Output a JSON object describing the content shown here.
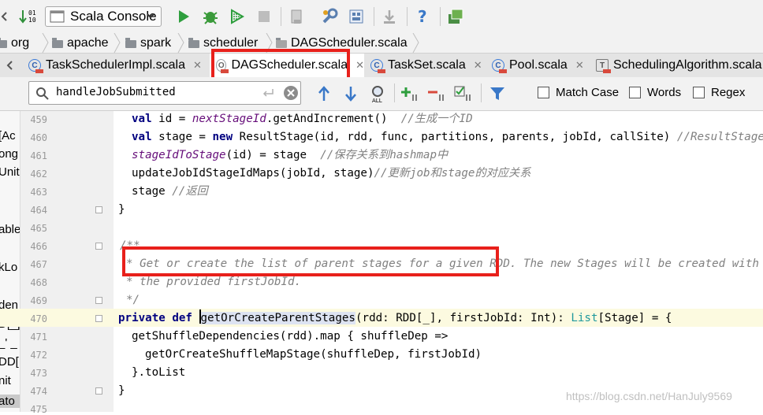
{
  "toolbar": {
    "run_config": "Scala Console",
    "icons": [
      "sort-down-icon",
      "run-icon",
      "debug-icon",
      "coverage-icon",
      "stop-icon",
      "build-icon",
      "wrench-icon",
      "project-structure-icon",
      "download-icon",
      "help-icon",
      "vcs-icon"
    ]
  },
  "breadcrumb": [
    "org",
    "apache",
    "spark",
    "scheduler",
    "DAGScheduler.scala"
  ],
  "tabs": [
    {
      "label": "TaskSchedulerImpl.scala",
      "icon": "class"
    },
    {
      "label": "DAGScheduler.scala",
      "icon": "object"
    },
    {
      "label": "TaskSet.scala",
      "icon": "class"
    },
    {
      "label": "Pool.scala",
      "icon": "class"
    },
    {
      "label": "SchedulingAlgorithm.scala",
      "icon": "trait"
    }
  ],
  "search": {
    "query": "handleJobSubmitted",
    "match_case": "Match Case",
    "words": "Words",
    "regex": "Regex"
  },
  "left_panel_fragments": [
    "[Ac",
    "ong",
    "Unit",
    "able",
    "kLo",
    "den",
    "D[_]",
    "_' _",
    "DD[",
    "nit",
    "ato"
  ],
  "line_numbers": [
    "459",
    "460",
    "461",
    "462",
    "463",
    "464",
    "465",
    "466",
    "467",
    "468",
    "469",
    "470",
    "471",
    "472",
    "473",
    "474",
    "475"
  ],
  "code": {
    "l459_a": "val",
    "l459_b": " id = ",
    "l459_c": "nextStageId",
    "l459_d": ".getAndIncrement()  ",
    "l459_e": "//生成一个ID",
    "l460_a": "val",
    "l460_b": " stage = ",
    "l460_c": "new",
    "l460_d": " ResultStage(id, rdd, func, partitions, parents, jobId, callSite) ",
    "l460_e": "//ResultStage",
    "l461_a": "stageIdToStage",
    "l461_b": "(id) = stage  ",
    "l461_c": "//保存关系到hashmap中",
    "l462_a": "updateJobIdStageIdMaps(jobId, stage)",
    "l462_b": "//更新job和stage的对应关系",
    "l463_a": "stage ",
    "l463_b": "//返回",
    "l464": "}",
    "l466": "/**",
    "l467_a": "* Get or create the list of parent stages for a given RDD.",
    "l467_b": " The new Stages will be created with",
    "l468": "* the provided firstJobId.",
    "l469": "*/",
    "l470_a": "private",
    "l470_b": " ",
    "l470_c": "def",
    "l470_d": " ",
    "l470_e": "getOrCreateParentStages",
    "l470_f": "(rdd: RDD[_], firstJobId: Int): ",
    "l470_g": "List",
    "l470_h": "[Stage] = {",
    "l471": "getShuffleDependencies(rdd).map { shuffleDep =>",
    "l472": "getOrCreateShuffleMapStage(shuffleDep, firstJobId)",
    "l473": "}.toList",
    "l474": "}"
  },
  "watermark": "https://blog.csdn.net/HanJuly9569",
  "colors": {
    "highlight_box": "#e8201b",
    "keyword": "#000080",
    "comment": "#808080",
    "field": "#660e7a"
  }
}
